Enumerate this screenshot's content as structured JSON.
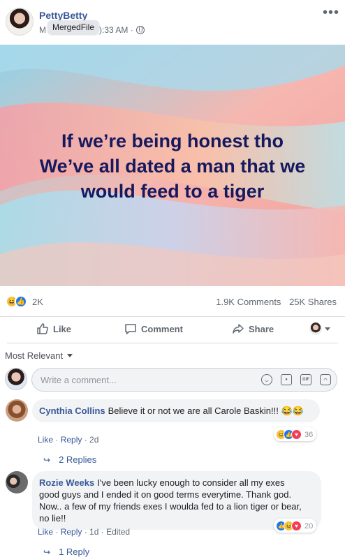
{
  "post": {
    "author": "PettyBetty",
    "meta_prefix": "M",
    "tooltip": "MergedFile",
    "meta_time": "):33 AM ·",
    "more_label": "•••",
    "image_text": [
      "If we’re being honest tho",
      "We’ve all dated a man that we",
      "would feed to a tiger"
    ]
  },
  "reactions": {
    "count": "2K",
    "comments": "1.9K Comments",
    "shares": "25K Shares"
  },
  "actions": {
    "like": "Like",
    "comment": "Comment",
    "share": "Share"
  },
  "sort": {
    "label": "Most Relevant"
  },
  "composer": {
    "placeholder": "Write a comment...",
    "gif_label": "GIF"
  },
  "comments": [
    {
      "name": "Cynthia Collins",
      "text": "Believe it or not we are all Carole Baskin!!! 😂😂",
      "text2": "😂😂",
      "reaction_count": "36",
      "like": "Like",
      "reply": "Reply",
      "time": "2d",
      "replies": "2 Replies"
    },
    {
      "name": "Rozie Weeks",
      "text": "I've been lucky enough to consider all my exes",
      "text_lines": [
        "good guys and I ended it on good terms everytime. Thank god.",
        "Now.. a few of my friends exes I woulda fed to a lion tiger or bear,",
        "no lie!!"
      ],
      "reaction_count": "20",
      "like": "Like",
      "reply": "Reply",
      "time": "1d",
      "edited": "Edited",
      "replies": "1 Reply"
    }
  ],
  "colors": {
    "link_blue": "#385898",
    "post_text": "#17195e",
    "like_blue": "#1877f2",
    "love_red": "#f33e58",
    "haha_yellow": "#f7c33d"
  }
}
